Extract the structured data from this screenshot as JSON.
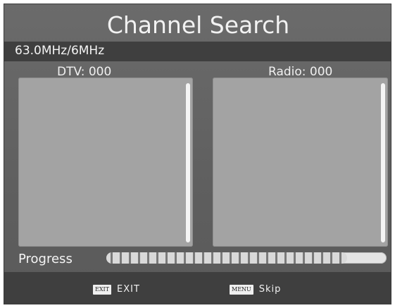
{
  "title": "Channel Search",
  "frequency": "63.0MHz/6MHz",
  "dtv": {
    "label": "DTV: 000"
  },
  "radio": {
    "label": "Radio: 000"
  },
  "progress": {
    "label": "Progress",
    "fraction": 0.86
  },
  "footer": {
    "exit": {
      "icon_text": "EXIT",
      "label": "EXIT",
      "icon": "exit-key-icon"
    },
    "skip": {
      "icon_text": "MENU",
      "label": "Skip",
      "icon": "menu-key-icon"
    }
  }
}
